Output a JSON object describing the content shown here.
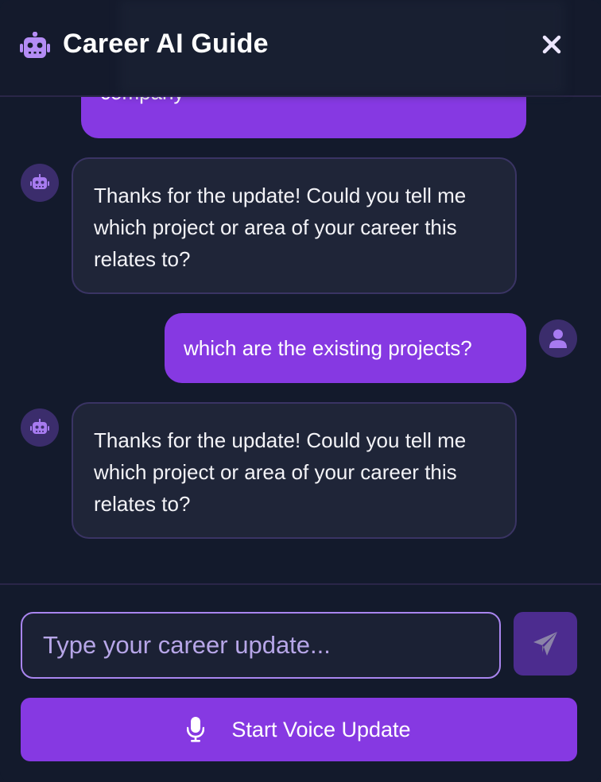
{
  "header": {
    "title": "Career AI Guide",
    "logo_icon": "robot-icon",
    "close_icon": "close-icon"
  },
  "messages": [
    {
      "sender": "user",
      "text": "company",
      "partial": true
    },
    {
      "sender": "bot",
      "text": "Thanks for the update! Could you tell me which project or area of your career this relates to?"
    },
    {
      "sender": "user",
      "text": "which are the existing projects?"
    },
    {
      "sender": "bot",
      "text": "Thanks for the update! Could you tell me which project or area of your career this relates to?"
    }
  ],
  "composer": {
    "placeholder": "Type your career update...",
    "value": "",
    "send_icon": "paper-plane-icon"
  },
  "voice_button": {
    "label": "Start Voice Update",
    "icon": "microphone-icon"
  },
  "colors": {
    "accent": "#8639e2",
    "background": "#131a2c",
    "bot_bubble": "#1f2538",
    "avatar": "#3b2d6c",
    "input_border": "#a985ef"
  }
}
